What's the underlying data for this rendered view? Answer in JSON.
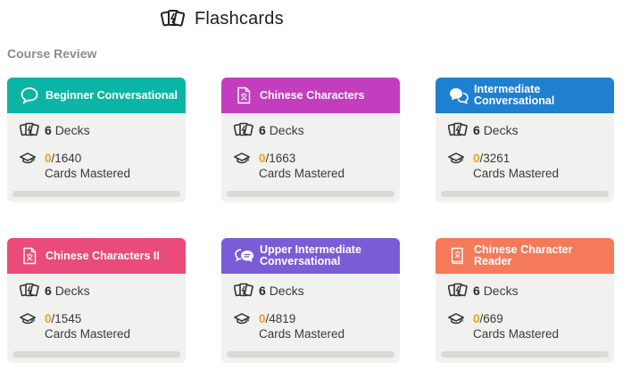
{
  "header": {
    "title": "Flashcards",
    "icon": "flashcards-icon"
  },
  "section_label": "Course Review",
  "cards": [
    {
      "name": "Beginner Conversational",
      "color": "#0bb5a5",
      "icon": "speech-bubble-icon",
      "decks_count": "6",
      "decks_label": "Decks",
      "mastered": "0",
      "total": "/1640",
      "mastered_label": "Cards Mastered",
      "progress": 0
    },
    {
      "name": "Chinese Characters",
      "color": "#c23ebe",
      "icon": "character-doc-icon",
      "decks_count": "6",
      "decks_label": "Decks",
      "mastered": "0",
      "total": "/1663",
      "mastered_label": "Cards Mastered",
      "progress": 0
    },
    {
      "name": "Intermediate Conversational",
      "color": "#1f7fd0",
      "icon": "chat-bubbles-icon",
      "decks_count": "6",
      "decks_label": "Decks",
      "mastered": "0",
      "total": "/3261",
      "mastered_label": "Cards Mastered",
      "progress": 0
    },
    {
      "name": "Chinese Characters II",
      "color": "#e94b7a",
      "icon": "character-doc-icon",
      "decks_count": "6",
      "decks_label": "Decks",
      "mastered": "0",
      "total": "/1545",
      "mastered_label": "Cards Mastered",
      "progress": 0
    },
    {
      "name": "Upper Intermediate Conversational",
      "color": "#7a5cd6",
      "icon": "chat-lines-icon",
      "decks_count": "6",
      "decks_label": "Decks",
      "mastered": "0",
      "total": "/4819",
      "mastered_label": "Cards Mastered",
      "progress": 0
    },
    {
      "name": "Chinese Character Reader",
      "color": "#f57a5a",
      "icon": "reader-book-icon",
      "decks_count": "6",
      "decks_label": "Decks",
      "mastered": "0",
      "total": "/669",
      "mastered_label": "Cards Mastered",
      "progress": 0
    }
  ]
}
